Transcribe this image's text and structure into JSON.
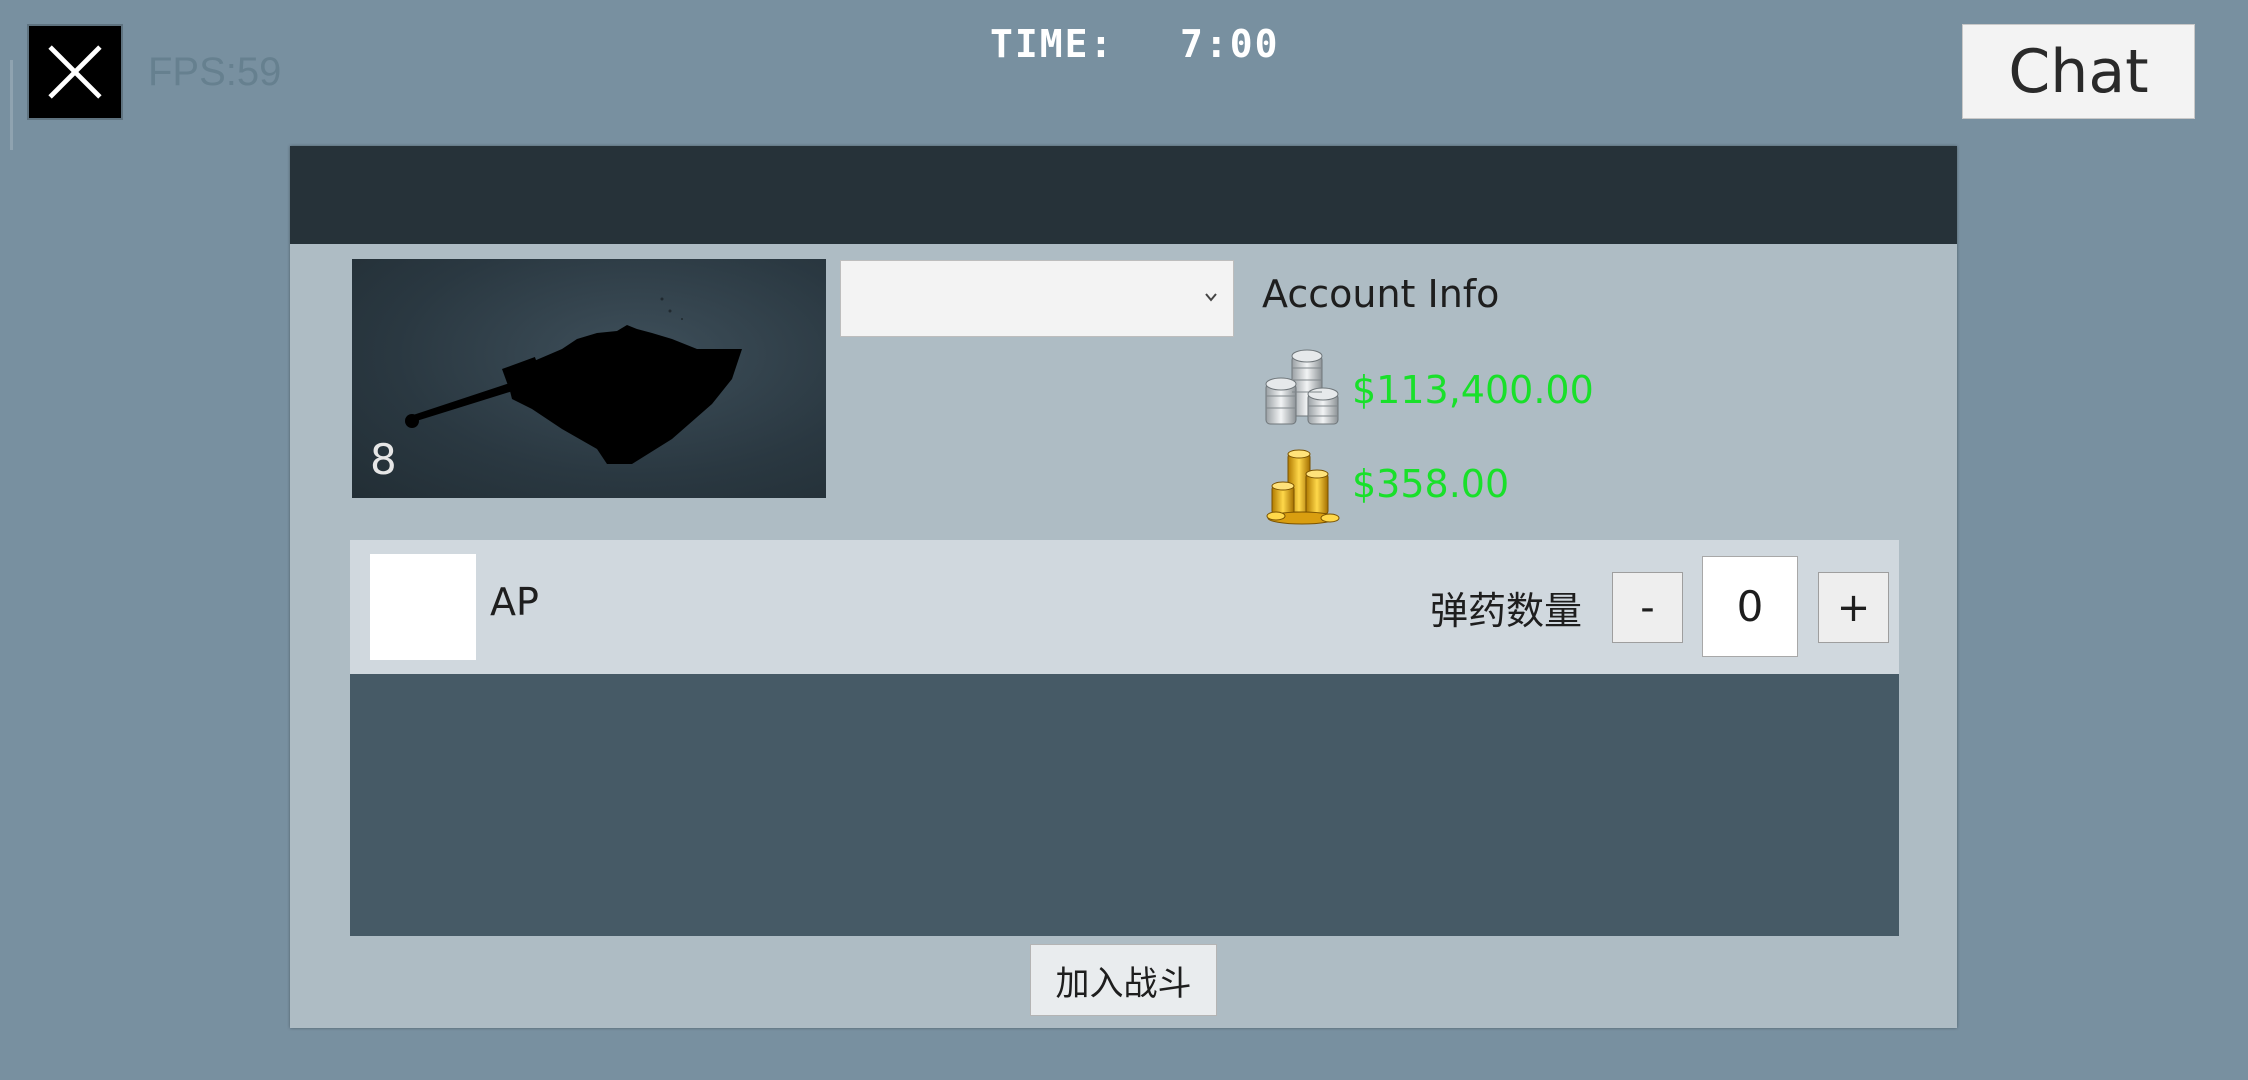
{
  "hud": {
    "fps_text": "FPS:59",
    "time_label": "TIME:",
    "time_value": "7:00",
    "chat_label": "Chat",
    "close_icon": "close-icon"
  },
  "vehicle": {
    "level": "8",
    "selected_option": ""
  },
  "account": {
    "title": "Account Info",
    "silver_amount": "$113,400.00",
    "gold_amount": "$358.00",
    "silver_icon": "silver-coins-icon",
    "gold_icon": "gold-coins-icon",
    "money_color": "#19e02a"
  },
  "ammo": {
    "name": "AP",
    "count_label": "弹药数量",
    "minus_label": "-",
    "plus_label": "+",
    "quantity": "0"
  },
  "actions": {
    "join_label": "加入战斗"
  },
  "colors": {
    "background": "#7890a0",
    "panel_header": "#263239",
    "panel_body": "#aebcc4",
    "ammo_list": "#465a66"
  }
}
